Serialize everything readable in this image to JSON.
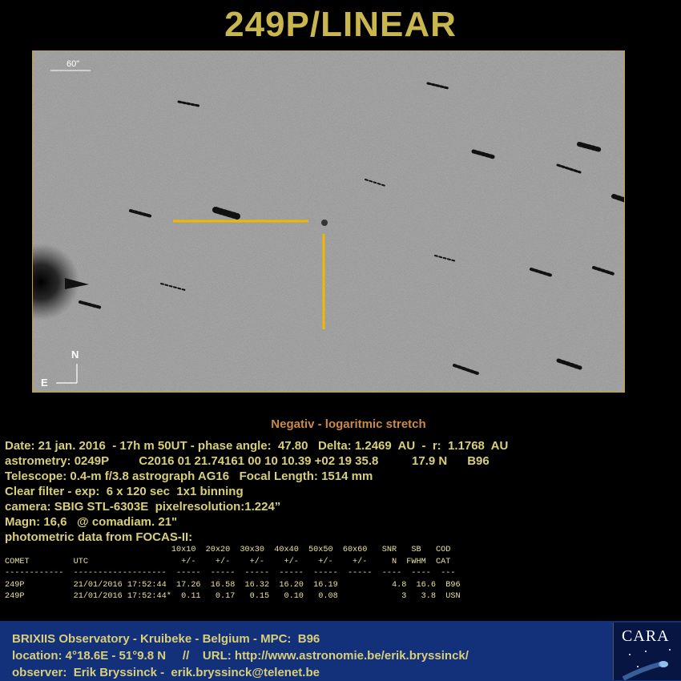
{
  "title": "249P/LINEAR",
  "image": {
    "scale_label": "60\"",
    "north_label": "N",
    "east_label": "E"
  },
  "subtitle": "Negativ - logaritmic stretch",
  "info_lines": [
    "Date: 21 jan. 2016  - 17h m 50UT - phase angle:  47.80   Delta: 1.2469  AU  -  r:  1.1768  AU",
    "astrometry: 0249P         C2016 01 21.74161 00 10 10.39 +02 19 35.8          17.9 N      B96",
    "Telescope: 0.4-m f/3.8 astrograph AG16   Focal Length: 1514 mm",
    "Clear filter - exp:  6 x 120 sec  1x1 binning",
    "camera: SBIG STL-6303E  pixelresolution:1.224”",
    "Magn: 16,6   @ comadiam. 21\"",
    "photometric data from FOCAS-II:"
  ],
  "photometry_lines": [
    "                                  10x10  20x20  30x30  40x40  50x50  60x60   SNR   SB   COD",
    "COMET         UTC                   +/-    +/-    +/-    +/-    +/-    +/-     N  FWHM  CAT",
    "------------  -------------------  -----  -----  -----  -----  -----  -----  ----  ----  ---",
    "249P          21/01/2016 17:52:44  17.26  16.58  16.32  16.20  16.19           4.8  16.6  B96",
    "249P          21/01/2016 17:52:44*  0.11   0.17   0.15   0.10   0.08             3   3.8  USN"
  ],
  "footer_lines": [
    "BRIXIIS Observatory - Kruibeke - Belgium - MPC:  B96",
    "location: 4°18.6E - 51°9.8 N     //    URL: http://www.astronomie.be/erik.bryssinck/",
    "observer:  Erik Bryssinck -  erik.bryssinck@telenet.be"
  ],
  "logo": {
    "text": "CARA"
  },
  "colors": {
    "title": "#c9b64e",
    "marker": "#f2b800",
    "footer_bg": "#13307a",
    "frame": "#c9a227"
  }
}
